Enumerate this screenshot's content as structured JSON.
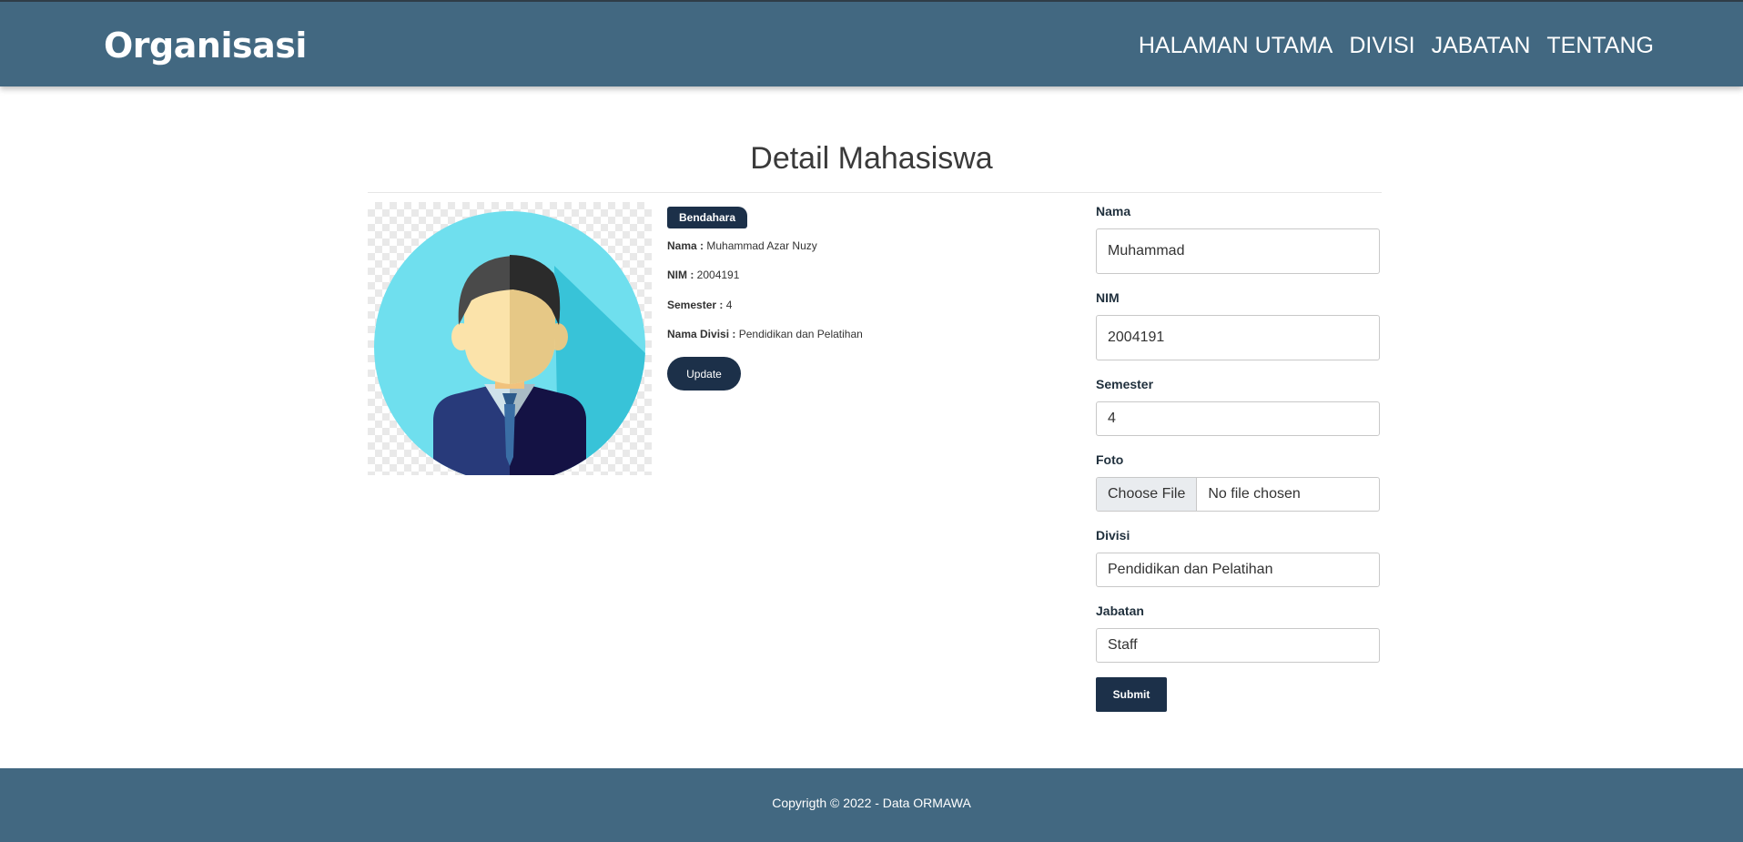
{
  "header": {
    "brand": "Organisasi",
    "nav": [
      "HALAMAN UTAMA",
      "DIVISI",
      "JABATAN",
      "TENTANG"
    ]
  },
  "page": {
    "title": "Detail Mahasiswa"
  },
  "detail": {
    "role_badge": "Bendahara",
    "nama_label": "Nama :",
    "nama_value": "Muhammad Azar Nuzy",
    "nim_label": "NIM :",
    "nim_value": "2004191",
    "semester_label": "Semester :",
    "semester_value": "4",
    "divisi_label": "Nama Divisi :",
    "divisi_value": "Pendidikan dan Pelatihan",
    "update_label": "Update",
    "photo_icon": "person-avatar-icon"
  },
  "form": {
    "nama_label": "Nama",
    "nama_value": "Muhammad",
    "nim_label": "NIM",
    "nim_value": "2004191",
    "semester_label": "Semester",
    "semester_value": "4",
    "foto_label": "Foto",
    "file_button": "Choose File",
    "file_status": "No file chosen",
    "divisi_label": "Divisi",
    "divisi_value": "Pendidikan dan Pelatihan",
    "jabatan_label": "Jabatan",
    "jabatan_value": "Staff",
    "submit_label": "Submit"
  },
  "footer": {
    "text": "Copyrigth © 2022 - Data ORMAWA"
  },
  "colors": {
    "primary": "#426881",
    "dark": "#1c3049"
  }
}
